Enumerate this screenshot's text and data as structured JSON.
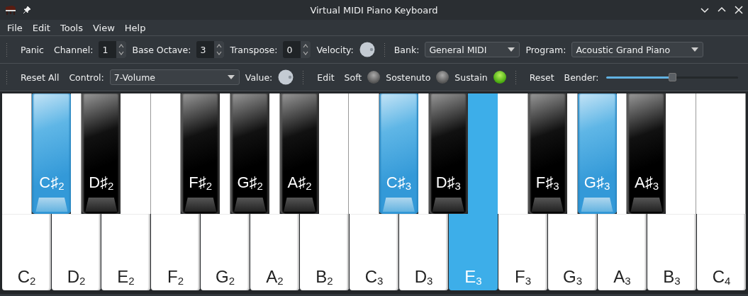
{
  "window": {
    "title": "Virtual MIDI Piano Keyboard"
  },
  "menu": [
    "File",
    "Edit",
    "Tools",
    "View",
    "Help"
  ],
  "toolbar_1": [
    {
      "kind": "button",
      "label": "Panic"
    },
    {
      "kind": "spin",
      "label": "Channel:",
      "value": "1"
    },
    {
      "kind": "spin",
      "label": "Base Octave:",
      "value": "3"
    },
    {
      "kind": "spin",
      "label": "Transpose:",
      "value": "0"
    },
    {
      "kind": "knob",
      "label": "Velocity:"
    },
    {
      "kind": "handle"
    },
    {
      "kind": "combo",
      "label": "Bank:",
      "value": "General MIDI"
    },
    {
      "kind": "combo",
      "label": "Program:",
      "value": "Acoustic Grand Piano"
    }
  ],
  "toolbar_2": [
    {
      "kind": "button",
      "label": "Reset All"
    },
    {
      "kind": "combo",
      "label": "Control:",
      "value": "7-Volume"
    },
    {
      "kind": "knob",
      "label": "Value:"
    },
    {
      "kind": "handle"
    },
    {
      "kind": "button",
      "label": "Edit"
    },
    {
      "kind": "led",
      "label": "Soft",
      "on": false
    },
    {
      "kind": "led",
      "label": "Sostenuto",
      "on": false
    },
    {
      "kind": "led",
      "label": "Sustain",
      "on": true
    },
    {
      "kind": "handle"
    },
    {
      "kind": "button",
      "label": "Reset"
    },
    {
      "kind": "slider",
      "label": "Bender:",
      "level": 0.51
    }
  ],
  "keys": [
    {
      "label": "C$_{2}$",
      "pressed": false,
      "sharp": {
        "label": "C♯$_{2}$",
        "pressed": true
      }
    },
    {
      "label": "D$_{2}$",
      "pressed": false,
      "sharp": {
        "label": "D♯$_{2}$",
        "pressed": false
      }
    },
    {
      "label": "E$_{2}$",
      "pressed": false
    },
    {
      "label": "F$_{2}$",
      "pressed": false,
      "sharp": {
        "label": "F♯$_{2}$",
        "pressed": false
      }
    },
    {
      "label": "G$_{2}$",
      "pressed": false,
      "sharp": {
        "label": "G♯$_{2}$",
        "pressed": false
      }
    },
    {
      "label": "A$_{2}$",
      "pressed": false,
      "sharp": {
        "label": "A♯$_{2}$",
        "pressed": false
      }
    },
    {
      "label": "B$_{2}$",
      "pressed": false
    },
    {
      "label": "C$_{3}$",
      "pressed": false,
      "sharp": {
        "label": "C♯$_{3}$",
        "pressed": true
      }
    },
    {
      "label": "D$_{3}$",
      "pressed": false,
      "sharp": {
        "label": "D♯$_{3}$",
        "pressed": false
      }
    },
    {
      "label": "E$_{3}$",
      "pressed": true
    },
    {
      "label": "F$_{3}$",
      "pressed": false,
      "sharp": {
        "label": "F♯$_{3}$",
        "pressed": false
      }
    },
    {
      "label": "G$_{3}$",
      "pressed": false,
      "sharp": {
        "label": "G♯$_{3}$",
        "pressed": true
      }
    },
    {
      "label": "A$_{3}$",
      "pressed": false,
      "sharp": {
        "label": "A♯$_{3}$",
        "pressed": false
      }
    },
    {
      "label": "B$_{3}$",
      "pressed": false
    },
    {
      "label": "C$_{4}$",
      "pressed": false
    }
  ]
}
